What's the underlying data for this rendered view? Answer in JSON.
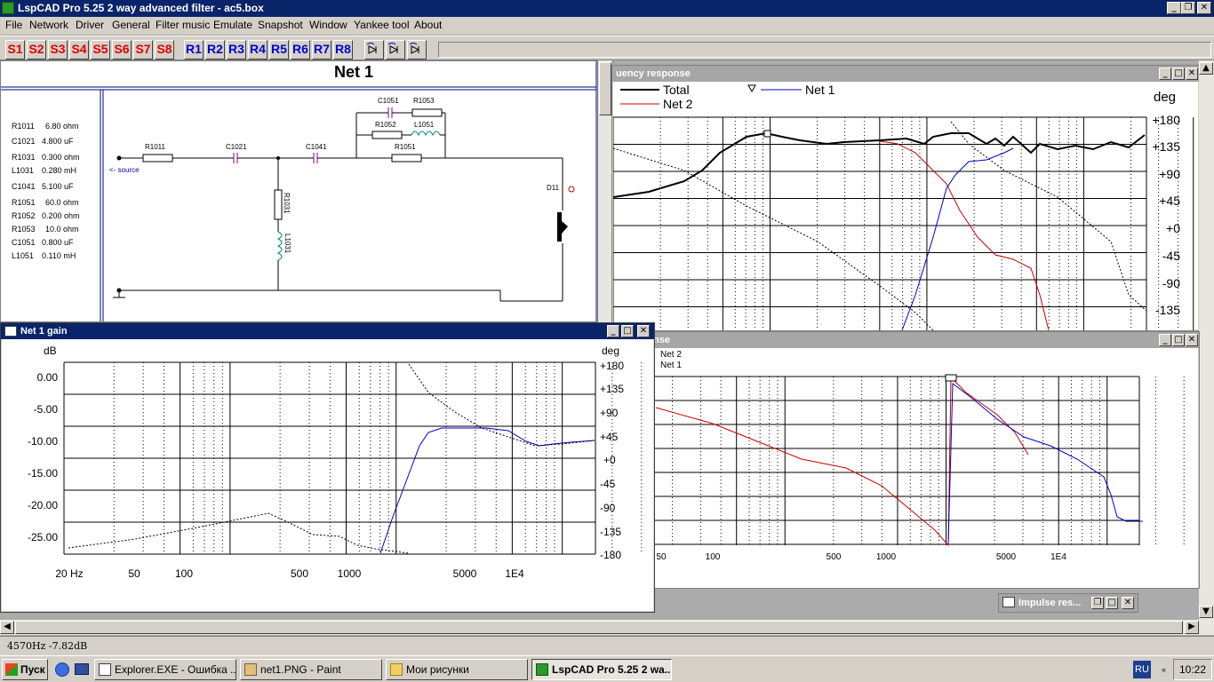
{
  "titlebar": {
    "title": "LspCAD Pro 5.25 2 way advanced filter - ac5.box",
    "min": "_",
    "restore": "❐",
    "close": "✕"
  },
  "menu": [
    "File",
    "Network",
    "Driver",
    "General",
    "Filter music",
    "Emulate",
    "Snapshot",
    "Window",
    "Yankee tool",
    "About"
  ],
  "toolbar": {
    "s_buttons": [
      "S1",
      "S2",
      "S3",
      "S4",
      "S5",
      "S6",
      "S7",
      "S8"
    ],
    "r_buttons": [
      "R1",
      "R2",
      "R3",
      "R4",
      "R5",
      "R6",
      "R7",
      "R8"
    ]
  },
  "schematic": {
    "title": "Net 1",
    "parts": [
      {
        "name": "R1011",
        "value": "6.80 ohm"
      },
      {
        "name": "C1021",
        "value": "4.800 uF"
      },
      {
        "name": "R1031",
        "value": "0.300 ohm"
      },
      {
        "name": "L1031",
        "value": "0.280 mH"
      },
      {
        "name": "C1041",
        "value": "5.100 uF"
      },
      {
        "name": "R1051",
        "value": "60.0 ohm"
      },
      {
        "name": "R1052",
        "value": "0.200 ohm"
      },
      {
        "name": "R1053",
        "value": "10.0 ohm"
      },
      {
        "name": "C1051",
        "value": "0.800 uF"
      },
      {
        "name": "L1051",
        "value": "0.110 mH"
      }
    ],
    "labels": {
      "r1011": "R1011",
      "c1021": "C1021",
      "c1041": "C1041",
      "c1051": "C1051",
      "r1053": "R1053",
      "r1052": "R1052",
      "l1051": "L1051",
      "r1051": "R1051",
      "r1031": "R1031",
      "l1031": "L1031",
      "d11": "D11",
      "source": "<- source"
    }
  },
  "freq_window": {
    "title": "uency response",
    "legend": [
      "Total",
      "Net 1",
      "Net 2"
    ],
    "ylabel": "deg",
    "yticks": [
      "+180",
      "+135",
      "+90",
      "+45",
      "+0",
      "-45",
      "-90",
      "-135"
    ],
    "colors": {
      "total": "#000000",
      "net1": "#0000cc",
      "net2": "#cc0000"
    }
  },
  "gain_window": {
    "title": "Net 1 gain",
    "ylabel_left": "dB",
    "ylabel_right": "deg",
    "yticks_left": [
      "0.00",
      "-5.00",
      "-10.00",
      "-15.00",
      "-20.00",
      "-25.00"
    ],
    "yticks_right": [
      "+180",
      "+135",
      "+90",
      "+45",
      "+0",
      "-45",
      "-90",
      "-135",
      "-180"
    ],
    "xticks": [
      "20 Hz",
      "50",
      "100",
      "500",
      "1000",
      "5000",
      "1E4"
    ]
  },
  "step_window": {
    "title": "nse",
    "legend": [
      "Net 2",
      "Net 1"
    ],
    "xticks": [
      "50",
      "100",
      "500",
      "1000",
      "5000",
      "1E4"
    ]
  },
  "impulse_window": {
    "title": "Impulse res..."
  },
  "status": {
    "text": "4570Hz  -7.82dB"
  },
  "taskbar": {
    "start": "Пуск",
    "tasks": [
      "Explorer.EXE - Ошибка ...",
      "net1.PNG - Paint",
      "Мои рисунки",
      "LspCAD Pro 5.25 2 wa..."
    ],
    "lang": "RU",
    "clock": "10:22"
  }
}
